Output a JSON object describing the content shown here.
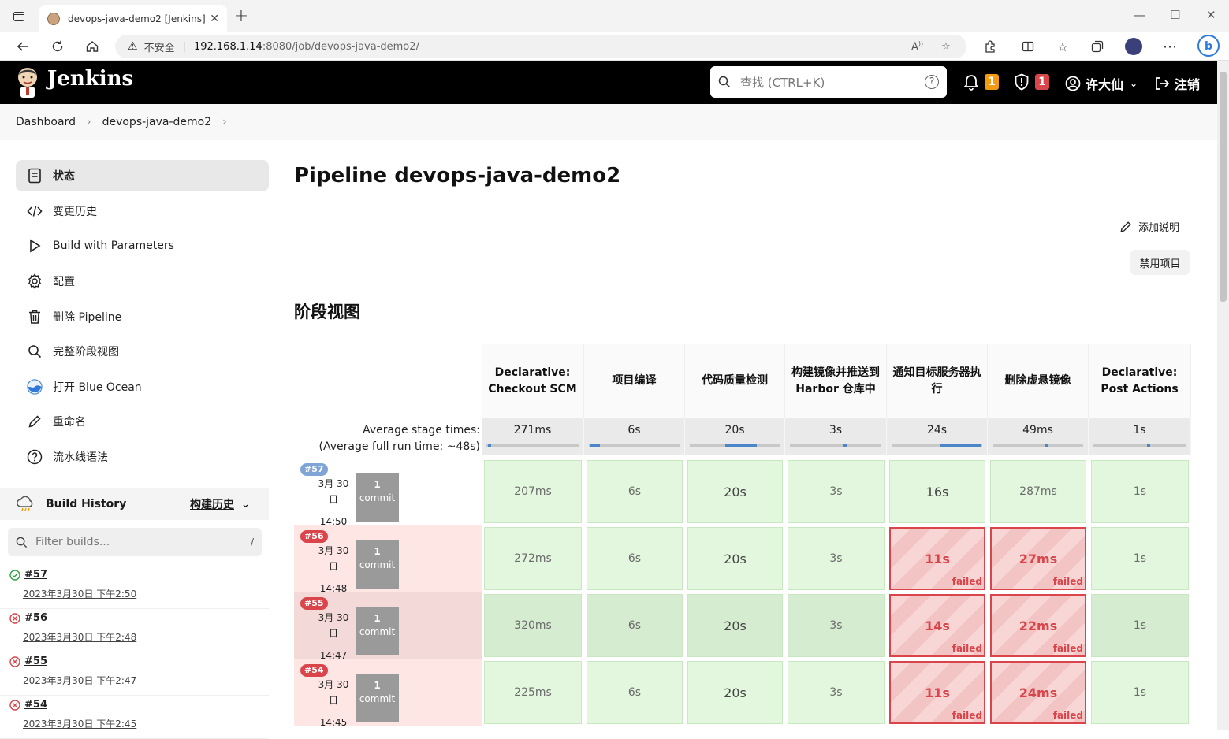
{
  "browser": {
    "tab_title": "devops-java-demo2 [Jenkins]",
    "security_label": "不安全",
    "url_host": "192.168.1.14",
    "url_rest": ":8080/job/devops-java-demo2/"
  },
  "header": {
    "brand": "Jenkins",
    "search_placeholder": "查找 (CTRL+K)",
    "notifications_count": "1",
    "security_count": "1",
    "user_name": "许大仙",
    "logout_label": "注销"
  },
  "breadcrumb": [
    "Dashboard",
    "devops-java-demo2"
  ],
  "sidebar": {
    "items": [
      {
        "label": "状态",
        "icon": "document-icon"
      },
      {
        "label": "变更历史",
        "icon": "code-icon"
      },
      {
        "label": "Build with Parameters",
        "icon": "play-icon"
      },
      {
        "label": "配置",
        "icon": "gear-icon"
      },
      {
        "label": "删除 Pipeline",
        "icon": "trash-icon"
      },
      {
        "label": "完整阶段视图",
        "icon": "search-icon"
      },
      {
        "label": "打开 Blue Ocean",
        "icon": "blue-ocean-icon"
      },
      {
        "label": "重命名",
        "icon": "pencil-icon"
      },
      {
        "label": "流水线语法",
        "icon": "question-icon"
      }
    ]
  },
  "build_history": {
    "title": "Build History",
    "trend_label": "构建历史",
    "filter_placeholder": "Filter builds...",
    "filter_shortcut": "/",
    "builds": [
      {
        "number": "#57",
        "date": "2023年3月30日 下午2:50",
        "status": "success"
      },
      {
        "number": "#56",
        "date": "2023年3月30日 下午2:48",
        "status": "failed"
      },
      {
        "number": "#55",
        "date": "2023年3月30日 下午2:47",
        "status": "failed"
      },
      {
        "number": "#54",
        "date": "2023年3月30日 下午2:45",
        "status": "failed"
      }
    ]
  },
  "main": {
    "title": "Pipeline devops-java-demo2",
    "add_description": "添加说明",
    "disable_project": "禁用项目",
    "stage_view_title": "阶段视图",
    "avg_label_1": "Average stage times:",
    "avg_label_2_pre": "(Average ",
    "avg_label_2_link": "full",
    "avg_label_2_post": " run time: ~48s)",
    "stages": [
      {
        "name": "Declarative: Checkout SCM",
        "avg": "271ms",
        "bar": 0.02
      },
      {
        "name": "项目编译",
        "avg": "6s",
        "bar": 0.1
      },
      {
        "name": "代码质量检测",
        "avg": "20s",
        "bar": 0.35
      },
      {
        "name": "构建镜像并推送到 Harbor 仓库中",
        "avg": "3s",
        "bar": 0.05
      },
      {
        "name": "通知目标服务器执行",
        "avg": "24s",
        "bar": 0.45
      },
      {
        "name": "删除虚悬镜像",
        "avg": "49ms",
        "bar": 0.02
      },
      {
        "name": "Declarative: Post Actions",
        "avg": "1s",
        "bar": 0.03
      }
    ],
    "runs": [
      {
        "badge": "#57",
        "badge_color": "#7fa4d6",
        "date_line1": "3月 30",
        "date_line2": "日",
        "time": "14:50",
        "commits": "1",
        "commit_label": "commit",
        "row_bg": "#ffffff",
        "cells": [
          {
            "v": "207ms",
            "s": "ok"
          },
          {
            "v": "6s",
            "s": "ok"
          },
          {
            "v": "20s",
            "s": "ok"
          },
          {
            "v": "3s",
            "s": "ok"
          },
          {
            "v": "16s",
            "s": "ok"
          },
          {
            "v": "287ms",
            "s": "ok"
          },
          {
            "v": "1s",
            "s": "ok"
          }
        ]
      },
      {
        "badge": "#56",
        "badge_color": "#d9454a",
        "date_line1": "3月 30",
        "date_line2": "日",
        "time": "14:48",
        "commits": "1",
        "commit_label": "commit",
        "row_bg": "#fde6e4",
        "cells": [
          {
            "v": "272ms",
            "s": "ok"
          },
          {
            "v": "6s",
            "s": "ok"
          },
          {
            "v": "20s",
            "s": "ok"
          },
          {
            "v": "3s",
            "s": "ok"
          },
          {
            "v": "11s",
            "s": "fail"
          },
          {
            "v": "27ms",
            "s": "fail"
          },
          {
            "v": "1s",
            "s": "ok"
          }
        ]
      },
      {
        "badge": "#55",
        "badge_color": "#d9454a",
        "date_line1": "3月 30",
        "date_line2": "日",
        "time": "14:47",
        "commits": "1",
        "commit_label": "commit",
        "row_bg": "#f3d9d7",
        "cells": [
          {
            "v": "320ms",
            "s": "okdark"
          },
          {
            "v": "6s",
            "s": "okdark"
          },
          {
            "v": "20s",
            "s": "okdark"
          },
          {
            "v": "3s",
            "s": "okdark"
          },
          {
            "v": "14s",
            "s": "fail"
          },
          {
            "v": "22ms",
            "s": "fail"
          },
          {
            "v": "1s",
            "s": "okdark"
          }
        ]
      },
      {
        "badge": "#54",
        "badge_color": "#d9454a",
        "date_line1": "3月 30",
        "date_line2": "日",
        "time": "14:45",
        "commits": "1",
        "commit_label": "commit",
        "row_bg": "#fde6e4",
        "cells": [
          {
            "v": "225ms",
            "s": "ok"
          },
          {
            "v": "6s",
            "s": "ok"
          },
          {
            "v": "20s",
            "s": "ok"
          },
          {
            "v": "3s",
            "s": "ok"
          },
          {
            "v": "11s",
            "s": "fail"
          },
          {
            "v": "24ms",
            "s": "fail"
          },
          {
            "v": "1s",
            "s": "ok"
          }
        ]
      }
    ],
    "failed_label": "failed"
  },
  "colors": {
    "accent": "#4a86c8",
    "success": "#2fa33f",
    "failure": "#d9454a",
    "header_bg": "#000000",
    "badge_orange": "#f39c12",
    "badge_red": "#d9454a"
  }
}
